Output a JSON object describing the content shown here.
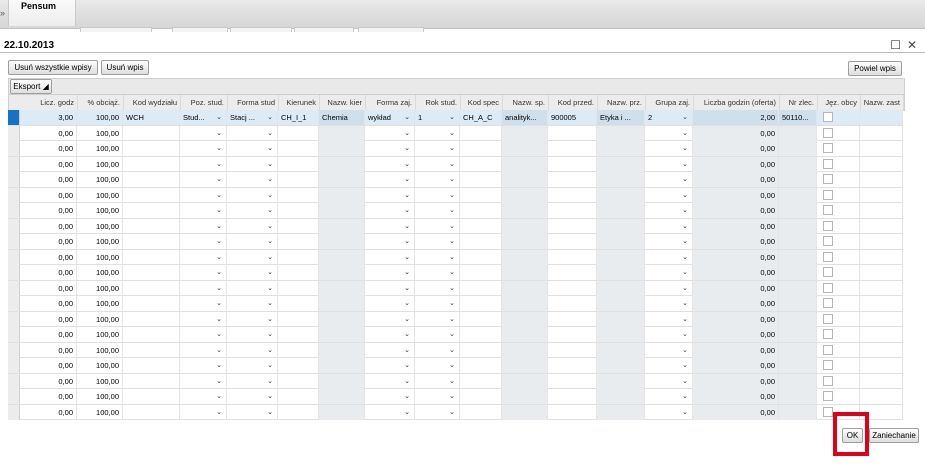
{
  "tabs": {
    "active": "Pensum",
    "arrow": "»"
  },
  "dialog": {
    "title": "22.10.2013",
    "maximize_icon": "maximize-icon",
    "close_icon": "close-icon"
  },
  "toolbar": {
    "remove_all": "Usuń wszystkie wpisy",
    "remove": "Usuń wpis",
    "repeat": "Powiel wpis",
    "export": "Eksport"
  },
  "columns": [
    "Licz. godz",
    "% obciąż.",
    "Kod wydziału",
    "Poz. stud.",
    "Forma stud",
    "Kierunek",
    "Nazw. kier",
    "Forma zaj.",
    "Rok stud.",
    "Kod spec",
    "Nazw. sp.",
    "Kod przed.",
    "Nazw. prz.",
    "Grupa zaj.",
    "Liczba godzin (oferta)",
    "Nr zlec.",
    "Jęz. obcy",
    "Nazw. zast"
  ],
  "rows": [
    {
      "licz": "3,00",
      "obc": "100,00",
      "wydz": "WCH",
      "poz": "Stud...",
      "forma": "Stacj ...",
      "kier": "CH_I_1",
      "nkier": "Chemia",
      "fzaj": "wykład",
      "rok": "1",
      "kspec": "CH_A_C",
      "nsp": "analityk...",
      "kprz": "900005",
      "nprz": "Etyka i ...",
      "grupa": "2",
      "oferta": "2,00",
      "zlec": "50110..."
    },
    {
      "licz": "0,00",
      "obc": "100,00",
      "oferta": "0,00"
    },
    {
      "licz": "0,00",
      "obc": "100,00",
      "oferta": "0,00"
    },
    {
      "licz": "0,00",
      "obc": "100,00",
      "oferta": "0,00"
    },
    {
      "licz": "0,00",
      "obc": "100,00",
      "oferta": "0,00"
    },
    {
      "licz": "0,00",
      "obc": "100,00",
      "oferta": "0,00"
    },
    {
      "licz": "0,00",
      "obc": "100,00",
      "oferta": "0,00"
    },
    {
      "licz": "0,00",
      "obc": "100,00",
      "oferta": "0,00"
    },
    {
      "licz": "0,00",
      "obc": "100,00",
      "oferta": "0,00"
    },
    {
      "licz": "0,00",
      "obc": "100,00",
      "oferta": "0,00"
    },
    {
      "licz": "0,00",
      "obc": "100,00",
      "oferta": "0,00"
    },
    {
      "licz": "0,00",
      "obc": "100,00",
      "oferta": "0,00"
    },
    {
      "licz": "0,00",
      "obc": "100,00",
      "oferta": "0,00"
    },
    {
      "licz": "0,00",
      "obc": "100,00",
      "oferta": "0,00"
    },
    {
      "licz": "0,00",
      "obc": "100,00",
      "oferta": "0,00"
    },
    {
      "licz": "0,00",
      "obc": "100,00",
      "oferta": "0,00"
    },
    {
      "licz": "0,00",
      "obc": "100,00",
      "oferta": "0,00"
    },
    {
      "licz": "0,00",
      "obc": "100,00",
      "oferta": "0,00"
    },
    {
      "licz": "0,00",
      "obc": "100,00",
      "oferta": "0,00"
    },
    {
      "licz": "0,00",
      "obc": "100,00",
      "oferta": "0,00"
    }
  ],
  "footer": {
    "ok": "OK",
    "cancel": "Zaniechanie"
  },
  "colors": {
    "selected_row": "#dcebf6",
    "row_marker": "#1672c4",
    "highlight": "#e0001a"
  }
}
